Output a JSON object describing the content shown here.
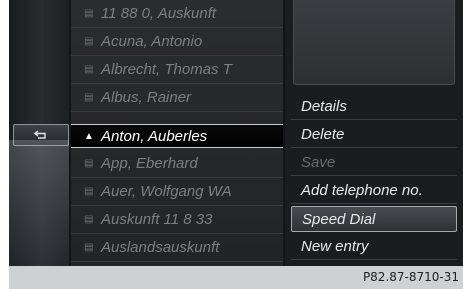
{
  "contacts": [
    {
      "label": "11 88 0, Auskunft",
      "icon": "phonebook-icon",
      "selected": false
    },
    {
      "label": "Acuna, Antonio",
      "icon": "phonebook-icon",
      "selected": false
    },
    {
      "label": "Albrecht, Thomas T",
      "icon": "phonebook-icon",
      "selected": false
    },
    {
      "label": "Albus, Rainer",
      "icon": "phonebook-icon",
      "selected": false
    },
    {
      "label": "Anton, Auberles",
      "icon": "person-icon",
      "selected": true
    },
    {
      "label": "App, Eberhard",
      "icon": "phonebook-icon",
      "selected": false
    },
    {
      "label": "Auer, Wolfgang WA",
      "icon": "phonebook-icon",
      "selected": false
    },
    {
      "label": "Auskunft 11 8 33",
      "icon": "phonebook-icon",
      "selected": false
    },
    {
      "label": "Auslandsauskunft",
      "icon": "phonebook-icon",
      "selected": false
    }
  ],
  "menu": {
    "items": [
      {
        "label": "Details",
        "state": "normal"
      },
      {
        "label": "Delete",
        "state": "normal"
      },
      {
        "label": "Save",
        "state": "disabled"
      },
      {
        "label": "Add telephone no.",
        "state": "normal"
      },
      {
        "label": "Speed Dial",
        "state": "highlighted"
      },
      {
        "label": "New entry",
        "state": "normal"
      }
    ]
  },
  "back_button_icon": "back-arrow-icon",
  "figure_code": "P82.87-8710-31",
  "colors": {
    "screen_bg": "#141416",
    "text_active": "#ffffff",
    "text_inactive": "#7c7e84",
    "caption_bg": "#cfd0d2"
  }
}
